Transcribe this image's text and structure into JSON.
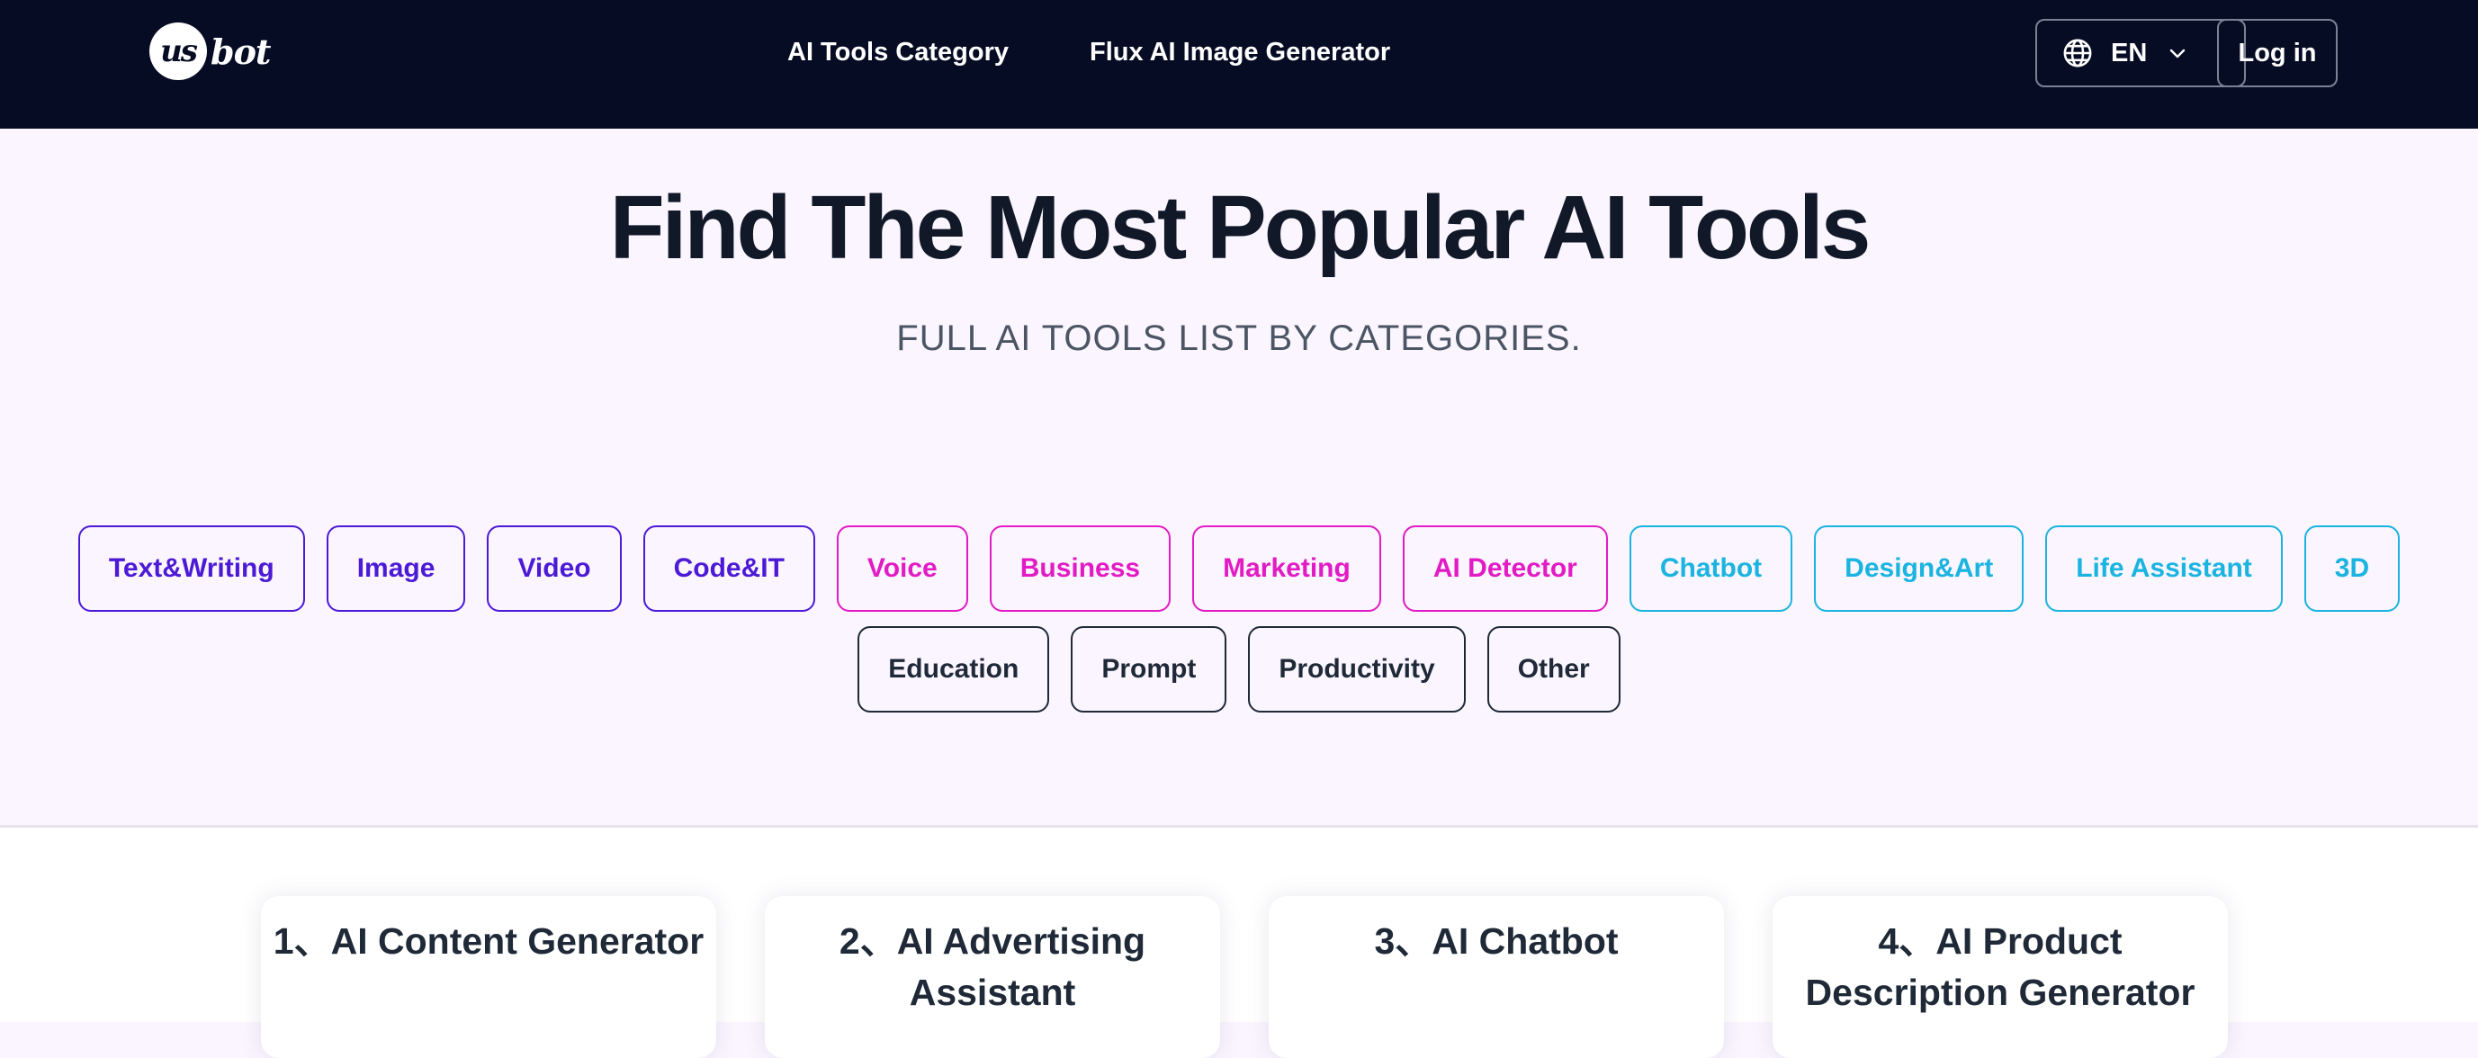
{
  "header": {
    "logo": {
      "mark": "us",
      "text": "bot"
    },
    "nav": [
      {
        "label": "AI Tools Category"
      },
      {
        "label": "Flux AI Image Generator"
      }
    ],
    "language": {
      "label": "EN",
      "icon": "globe-icon",
      "dropdown_icon": "chevron-down-icon"
    },
    "login_label": "Log in",
    "background_color": "#060c24"
  },
  "hero": {
    "title": "Find The Most Popular AI Tools",
    "subtitle": "FULL AI TOOLS LIST BY CATEGORIES."
  },
  "categories": [
    {
      "label": "Text&Writing",
      "color": "#4c1ad6"
    },
    {
      "label": "Image",
      "color": "#4c1ad6"
    },
    {
      "label": "Video",
      "color": "#4c1ad6"
    },
    {
      "label": "Code&IT",
      "color": "#4c1ad6"
    },
    {
      "label": "Voice",
      "color": "#e21bc4"
    },
    {
      "label": "Business",
      "color": "#e21bc4"
    },
    {
      "label": "Marketing",
      "color": "#e21bc4"
    },
    {
      "label": "AI Detector",
      "color": "#e21bc4"
    },
    {
      "label": "Chatbot",
      "color": "#1ab4e0"
    },
    {
      "label": "Design&Art",
      "color": "#1ab4e0"
    },
    {
      "label": "Life Assistant",
      "color": "#1ab4e0"
    },
    {
      "label": "3D",
      "color": "#1ab4e0"
    },
    {
      "label": "Education",
      "color": "#1f2937"
    },
    {
      "label": "Prompt",
      "color": "#1f2937"
    },
    {
      "label": "Productivity",
      "color": "#1f2937"
    },
    {
      "label": "Other",
      "color": "#1f2937"
    }
  ],
  "cards": [
    {
      "title": "1、AI Content Generator"
    },
    {
      "title": "2、AI Advertising Assistant"
    },
    {
      "title": "3、AI Chatbot"
    },
    {
      "title": "4、AI Product Description Generator"
    }
  ]
}
